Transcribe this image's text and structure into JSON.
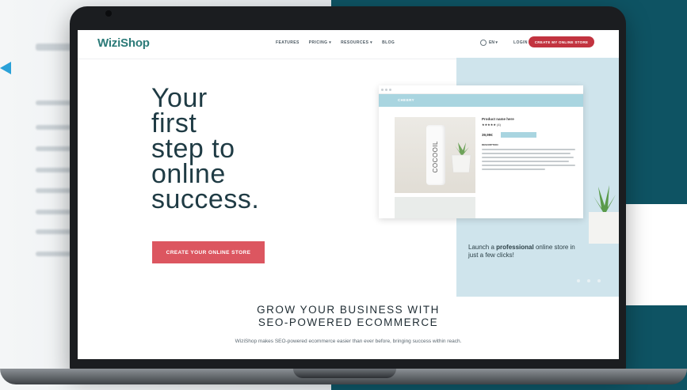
{
  "site": {
    "logo": "WiziShop",
    "nav": [
      "FEATURES",
      "PRICING ▾",
      "RESOURCES ▾",
      "BLOG"
    ],
    "language": "EN ▾",
    "login": "LOGIN",
    "cta_top": "CREATE MY ONLINE STORE"
  },
  "hero": {
    "title_lines": [
      "Your",
      "first",
      "step to",
      "online",
      "success."
    ],
    "cta": "CREATE YOUR ONLINE STORE",
    "launch_prefix": "Launch a ",
    "launch_bold": "professional",
    "launch_suffix": " online store in just a few clicks!"
  },
  "mockup": {
    "store_name": "CHEERY",
    "product_name": "Product name here",
    "stars": "★★★★★ (4)",
    "price": "39,99€",
    "description_label": "DESCRIPTION",
    "bottle_text": "COCOOIL"
  },
  "section": {
    "heading_line1": "GROW YOUR BUSINESS WITH",
    "heading_line2": "SEO-POWERED ECOMMERCE",
    "subtext": "WiziShop makes SEO-powered ecommerce easier than ever before, bringing success within reach."
  },
  "colors": {
    "brand_teal": "#2b7a78",
    "brand_green": "#9ac14a",
    "cta_red": "#c2333f",
    "hero_cta": "#dc5660",
    "panel_blue": "#cfe4ec",
    "background_teal": "#0e5363"
  }
}
